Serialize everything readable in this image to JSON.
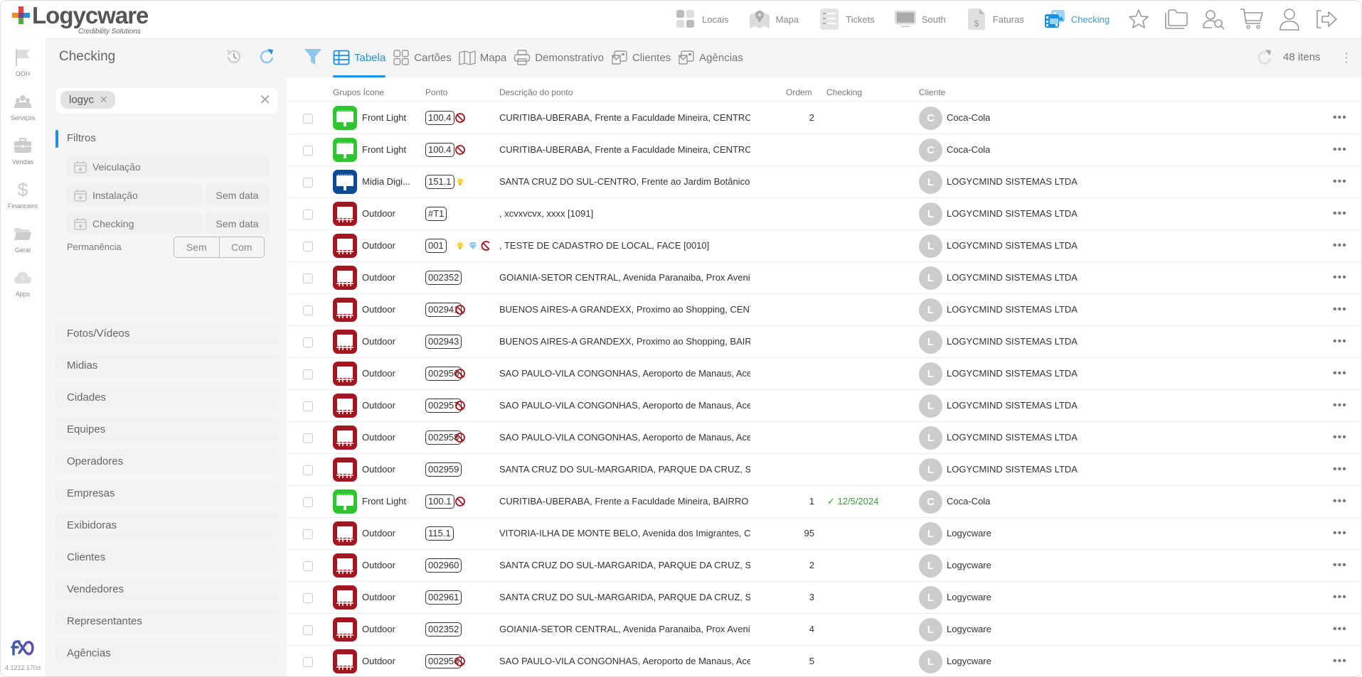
{
  "brand": {
    "name": "Logycware",
    "tagline": "Credibility Solutions"
  },
  "topnav": [
    {
      "label": "Locais",
      "icon": "grid-icon"
    },
    {
      "label": "Mapa",
      "icon": "map-pin-icon"
    },
    {
      "label": "Tickets",
      "icon": "checklist-icon"
    },
    {
      "label": "South",
      "icon": "monitor-icon"
    },
    {
      "label": "Faturas",
      "icon": "invoice-icon"
    },
    {
      "label": "Checking",
      "icon": "image-gallery-icon",
      "active": true
    }
  ],
  "topicons": [
    "star-icon",
    "folder-icon",
    "user-search-icon",
    "cart-icon",
    "user-icon",
    "logout-icon"
  ],
  "rail": [
    {
      "label": "OOH",
      "icon": "flag-icon"
    },
    {
      "label": "Serviços",
      "icon": "team-icon"
    },
    {
      "label": "Vendas",
      "icon": "briefcase-icon"
    },
    {
      "label": "Financeiro",
      "icon": "dollar-icon"
    },
    {
      "label": "Geral",
      "icon": "folder-open-icon"
    },
    {
      "label": "Apps",
      "icon": "cloud-plus-icon"
    }
  ],
  "version": "4.1212.170d",
  "panel": {
    "title": "Checking",
    "search_chip": "logyc",
    "filters_label": "Filtros",
    "veiculacao": "Veiculação",
    "instalacao": "Instalação",
    "instalacao_value": "Sem data",
    "checking": "Checking",
    "checking_value": "Sem data",
    "permanencia": "Permanência",
    "perm_sem": "Sem",
    "perm_com": "Com",
    "sections": [
      "Fotos/Vídeos",
      "Midias",
      "Cidades",
      "Equipes",
      "Operadores",
      "Empresas",
      "Exibidoras",
      "Clientes",
      "Vendedores",
      "Representantes",
      "Agências"
    ]
  },
  "toolbar": {
    "tabs": [
      {
        "label": "Tabela",
        "icon": "table-icon",
        "active": true
      },
      {
        "label": "Cartões",
        "icon": "cards-icon"
      },
      {
        "label": "Mapa",
        "icon": "map-icon"
      },
      {
        "label": "Demonstrativo",
        "icon": "printer-icon"
      },
      {
        "label": "Clientes",
        "icon": "mail-photo-icon"
      },
      {
        "label": "Agências",
        "icon": "mail-photo-icon"
      }
    ],
    "count": "48 itens"
  },
  "columns": {
    "grupo": "Grupos Ícone",
    "ponto": "Ponto",
    "desc": "Descrição do ponto",
    "ordem": "Ordem",
    "checking": "Checking",
    "cliente": "Cliente"
  },
  "colors": {
    "accent": "#1e90e0",
    "frontlight": "#2ec52e",
    "digital": "#0b4a94",
    "outdoor": "#a3151f",
    "check": "#3a9a3a"
  },
  "rows": [
    {
      "group": "Front Light",
      "type": "frontlight",
      "ponto": "100.4",
      "flags": [
        "blocked"
      ],
      "desc": "CURITIBA-UBERABA, Frente a Faculdade Mineira, CENTRO ->",
      "ordem": "2",
      "checking": "",
      "avatar": "C",
      "cliente": "Coca-Cola"
    },
    {
      "group": "Front Light",
      "type": "frontlight",
      "ponto": "100.4",
      "flags": [
        "blocked"
      ],
      "desc": "CURITIBA-UBERABA, Frente a Faculdade Mineira, CENTRO ->",
      "ordem": "",
      "checking": "",
      "avatar": "C",
      "cliente": "Coca-Cola"
    },
    {
      "group": "Midia Digi...",
      "type": "digital",
      "ponto": "151.1",
      "flags": [
        "light"
      ],
      "desc": "SANTA CRUZ DO SUL-CENTRO, Frente ao Jardim Botânico, E",
      "ordem": "",
      "checking": "",
      "avatar": "L",
      "cliente": "LOGYCMIND SISTEMAS LTDA"
    },
    {
      "group": "Outdoor",
      "type": "outdoor",
      "ponto": "#T1",
      "flags": [],
      "desc": ", xcvxvcvx, xxxx [1091]",
      "ordem": "",
      "checking": "",
      "avatar": "L",
      "cliente": "LOGYCMIND SISTEMAS LTDA"
    },
    {
      "group": "Outdoor",
      "type": "outdoor",
      "ponto": "001",
      "flags": [
        "light",
        "diamond",
        "partial"
      ],
      "desc": ", TESTE DE CADASTRO DE LOCAL, FACE [0010]",
      "ordem": "",
      "checking": "",
      "avatar": "L",
      "cliente": "LOGYCMIND SISTEMAS LTDA"
    },
    {
      "group": "Outdoor",
      "type": "outdoor",
      "ponto": "002352",
      "flags": [],
      "desc": "GOIANIA-SETOR CENTRAL, Avenida Paranaiba, Prox Avenida",
      "ordem": "",
      "checking": "",
      "avatar": "L",
      "cliente": "LOGYCMIND SISTEMAS LTDA"
    },
    {
      "group": "Outdoor",
      "type": "outdoor",
      "ponto": "002941",
      "flags": [
        "blocked"
      ],
      "desc": "BUENOS AIRES-A GRANDEXX, Proximo ao Shopping, CENTRO",
      "ordem": "",
      "checking": "",
      "avatar": "L",
      "cliente": "LOGYCMIND SISTEMAS LTDA"
    },
    {
      "group": "Outdoor",
      "type": "outdoor",
      "ponto": "002943",
      "flags": [],
      "desc": "BUENOS AIRES-A GRANDEXX, Proximo ao Shopping, BAIRRO",
      "ordem": "",
      "checking": "",
      "avatar": "L",
      "cliente": "LOGYCMIND SISTEMAS LTDA"
    },
    {
      "group": "Outdoor",
      "type": "outdoor",
      "ponto": "002956",
      "flags": [
        "blocked"
      ],
      "desc": "SAO PAULO-VILA CONGONHAS, Aeroporto de Manaus, Acesso",
      "ordem": "",
      "checking": "",
      "avatar": "L",
      "cliente": "LOGYCMIND SISTEMAS LTDA"
    },
    {
      "group": "Outdoor",
      "type": "outdoor",
      "ponto": "002957",
      "flags": [
        "blocked"
      ],
      "desc": "SAO PAULO-VILA CONGONHAS, Aeroporto de Manaus, Acesso",
      "ordem": "",
      "checking": "",
      "avatar": "L",
      "cliente": "LOGYCMIND SISTEMAS LTDA"
    },
    {
      "group": "Outdoor",
      "type": "outdoor",
      "ponto": "002958",
      "flags": [
        "blocked"
      ],
      "desc": "SAO PAULO-VILA CONGONHAS, Aeroporto de Manaus, Acesso",
      "ordem": "",
      "checking": "",
      "avatar": "L",
      "cliente": "LOGYCMIND SISTEMAS LTDA"
    },
    {
      "group": "Outdoor",
      "type": "outdoor",
      "ponto": "002959",
      "flags": [],
      "desc": "SANTA CRUZ DO SUL-MARGARIDA, PARQUE DA CRUZ, SENTIDO",
      "ordem": "",
      "checking": "",
      "avatar": "L",
      "cliente": "LOGYCMIND SISTEMAS LTDA"
    },
    {
      "group": "Front Light",
      "type": "frontlight",
      "ponto": "100.1",
      "flags": [
        "blocked"
      ],
      "desc": "CURITIBA-UBERABA, Frente a Faculdade Mineira, BAIRRO ->",
      "ordem": "1",
      "checking": "12/5/2024",
      "avatar": "C",
      "cliente": "Coca-Cola"
    },
    {
      "group": "Outdoor",
      "type": "outdoor",
      "ponto": "115.1",
      "flags": [],
      "desc": "VITORIA-ILHA DE MONTE BELO, Avenida dos Imigrantes, CE",
      "ordem": "95",
      "checking": "",
      "avatar": "L",
      "cliente": "Logycware"
    },
    {
      "group": "Outdoor",
      "type": "outdoor",
      "ponto": "002960",
      "flags": [],
      "desc": "SANTA CRUZ DO SUL-MARGARIDA, PARQUE DA CRUZ, SENTIDO",
      "ordem": "2",
      "checking": "",
      "avatar": "L",
      "cliente": "Logycware"
    },
    {
      "group": "Outdoor",
      "type": "outdoor",
      "ponto": "002961",
      "flags": [],
      "desc": "SANTA CRUZ DO SUL-MARGARIDA, PARQUE DA CRUZ, SENTIDO",
      "ordem": "3",
      "checking": "",
      "avatar": "L",
      "cliente": "Logycware"
    },
    {
      "group": "Outdoor",
      "type": "outdoor",
      "ponto": "002352",
      "flags": [],
      "desc": "GOIANIA-SETOR CENTRAL, Avenida Paranaiba, Prox Avenida",
      "ordem": "4",
      "checking": "",
      "avatar": "L",
      "cliente": "Logycware"
    },
    {
      "group": "Outdoor",
      "type": "outdoor",
      "ponto": "002956",
      "flags": [
        "blocked"
      ],
      "desc": "SAO PAULO-VILA CONGONHAS, Aeroporto de Manaus, Acesso",
      "ordem": "5",
      "checking": "",
      "avatar": "L",
      "cliente": "Logycware"
    }
  ]
}
